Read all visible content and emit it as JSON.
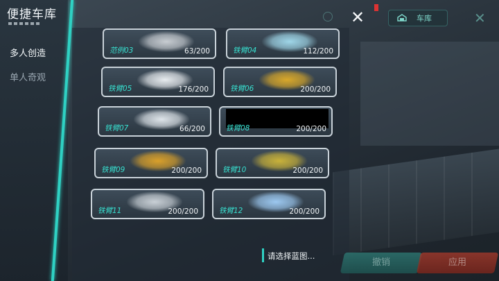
{
  "header": {
    "title": "便捷车库"
  },
  "sidebar": {
    "items": [
      {
        "label": "多人创造",
        "active": true
      },
      {
        "label": "单人奇观",
        "active": false
      }
    ]
  },
  "top_right": {
    "garage_label": "车库"
  },
  "blueprints": [
    {
      "name": "范例03",
      "count": "63/200"
    },
    {
      "name": "铁臂04",
      "count": "112/200"
    },
    {
      "name": "铁臂05",
      "count": "176/200"
    },
    {
      "name": "铁臂06",
      "count": "200/200"
    },
    {
      "name": "铁臂07",
      "count": "66/200"
    },
    {
      "name": "铁臂08",
      "count": "200/200"
    },
    {
      "name": "铁臂09",
      "count": "200/200"
    },
    {
      "name": "铁臂10",
      "count": "200/200"
    },
    {
      "name": "铁臂11",
      "count": "200/200"
    },
    {
      "name": "铁臂12",
      "count": "200/200"
    }
  ],
  "footer": {
    "hint": "请选择蓝图...",
    "cancel_label": "撤销",
    "apply_label": "应用"
  },
  "colors": {
    "accent": "#2fd1c3",
    "name_text": "#38e0d0",
    "apply": "#a3392b",
    "cancel": "#2f7e78"
  }
}
